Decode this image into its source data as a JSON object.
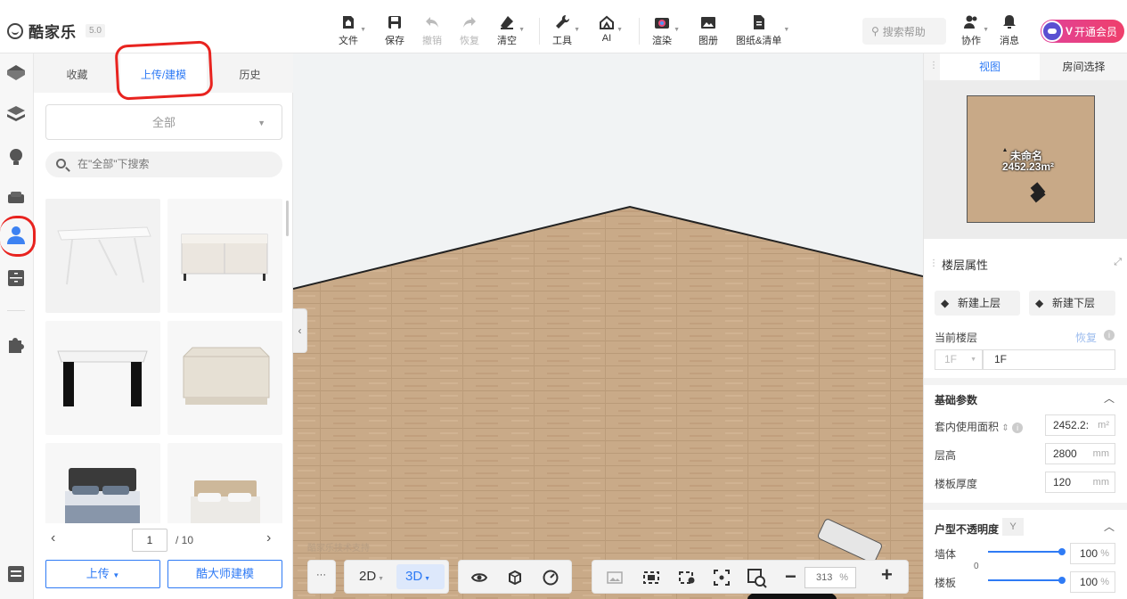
{
  "app": {
    "name": "酷家乐",
    "version": "5.0"
  },
  "toolbar": {
    "file": "文件",
    "save": "保存",
    "undo": "撤销",
    "redo": "恢复",
    "clear": "清空",
    "tools": "工具",
    "ai": "AI",
    "render": "渲染",
    "album": "图册",
    "drawings": "图纸&清单"
  },
  "header_right": {
    "search_placeholder": "搜索帮助",
    "collab": "协作",
    "messages": "消息",
    "vip": "开通会员"
  },
  "left_panel": {
    "tabs": [
      "收藏",
      "上传/建模",
      "历史"
    ],
    "category_select": "全部",
    "search_placeholder": "在\"全部\"下搜索",
    "page_current": "1",
    "page_total": "/ 10",
    "upload_button": "上传",
    "master_button": "酷大师建模"
  },
  "canvas": {
    "watermark": "酷家乐技术支持",
    "view_2d": "2D",
    "view_3d": "3D",
    "more": "···",
    "zoom_value": "313",
    "zoom_unit": "%"
  },
  "right_panel": {
    "tabs": [
      "视图",
      "房间选择"
    ],
    "room_name": "未命名",
    "room_area": "2452.23m²",
    "floor_props_title": "楼层属性",
    "new_upper": "新建上层",
    "new_lower": "新建下层",
    "current_floor_label": "当前楼层",
    "restore": "恢复",
    "floor_select": "1F",
    "floor_name": "1F",
    "basic_params_title": "基础参数",
    "area_label": "套内使用面积",
    "area_value": "2452.2:",
    "area_unit": "m²",
    "height_label": "层高",
    "height_value": "2800",
    "height_unit": "mm",
    "slab_label": "楼板厚度",
    "slab_value": "120",
    "slab_unit": "mm",
    "opacity_title": "户型不透明度",
    "wall_label": "墙体",
    "wall_value": "100",
    "floor_label": "楼板",
    "floor_value": "100",
    "pct": "%",
    "slider_min": "0"
  },
  "colors": {
    "accent": "#2f7bf5",
    "annotation_red": "#e8231f",
    "wood": "#c8a987"
  }
}
